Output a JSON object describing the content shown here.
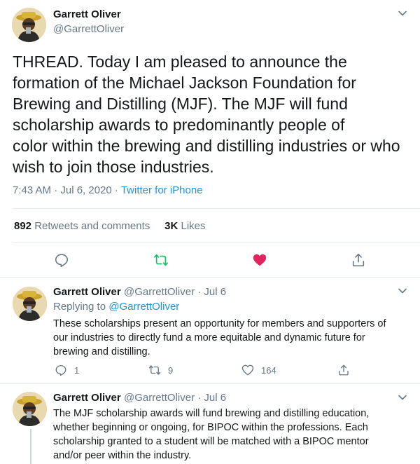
{
  "main_tweet": {
    "author_name": "Garrett Oliver",
    "handle": "@GarrettOliver",
    "text_lines": [
      "THREAD. Today I am pleased to announce the",
      "formation of the Michael Jackson Foundation for",
      "Brewing and Distilling (MJF). The MJF will fund",
      "scholarship awards to predominantly people of",
      "color within the brewing and distilling industries or who",
      "wish to join those industries."
    ],
    "timestamp": "7:43 AM · Jul 6, 2020 · ",
    "source": "Twitter for iPhone",
    "retweets_count": "892",
    "retweets_label": "Retweets and comments",
    "likes_count": "3K",
    "likes_label": "Likes",
    "liked": true,
    "retweeted": false
  },
  "replies": [
    {
      "author_name": "Garrett Oliver",
      "handle_date": "@GarrettOliver · Jul 6",
      "replying_prefix": "Replying to ",
      "replying_to": "@GarrettOliver",
      "text_lines": [
        "These scholarships present an opportunity for members and supporters of",
        "our industries to directly fund a more equitable and dynamic future for",
        "brewing and distilling."
      ],
      "reply_count": "1",
      "retweet_count": "9",
      "like_count": "164"
    },
    {
      "author_name": "Garrett Oliver",
      "handle_date": "@GarrettOliver · Jul 6",
      "text_lines": [
        "The MJF scholarship awards will fund brewing and distilling education,",
        "whether beginning or ongoing, for BIPOC within the professions. Each",
        "scholarship granted to a student will be matched with a BIPOC mentor",
        "and/or peer within the industry."
      ]
    }
  ],
  "colors": {
    "text": "#14171a",
    "secondary": "#657786",
    "link": "#1b95e0",
    "retweet_green": "#17bf63",
    "like_red": "#e0245e",
    "border": "#e6ecf0"
  },
  "icons": {
    "reply": "comment-icon",
    "retweet": "retweet-icon",
    "like": "heart-icon",
    "share": "share-icon",
    "more": "chevron-down-icon"
  }
}
